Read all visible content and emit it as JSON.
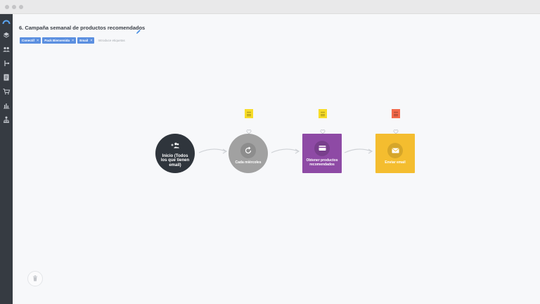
{
  "window": {
    "title": ""
  },
  "sidebar": {
    "items": [
      {
        "icon": "dashboard-logo-icon",
        "active": true
      },
      {
        "icon": "layers-icon"
      },
      {
        "icon": "users-icon"
      },
      {
        "icon": "flow-icon"
      },
      {
        "icon": "document-icon"
      },
      {
        "icon": "cart-icon"
      },
      {
        "icon": "bar-chart-icon"
      },
      {
        "icon": "org-chart-icon"
      }
    ]
  },
  "campaign": {
    "title": "6. Campaña semanal de productos recomendados",
    "tags": [
      {
        "label": "Conectif"
      },
      {
        "label": "Pack Bienvenida"
      },
      {
        "label": "Email"
      }
    ],
    "tag_placeholder": "Introduce etiquetas"
  },
  "flow": {
    "nodes": [
      {
        "id": "start",
        "label": "Inicio (Todos los que tienen email)",
        "color": "#2f353c",
        "icon": "add-users-icon"
      },
      {
        "id": "schedule",
        "label": "Cada miércoles",
        "color": "#a1a1a1",
        "icon": "refresh-icon"
      },
      {
        "id": "products",
        "label": "Obtener productos recomendados",
        "color": "#8e4aa5",
        "icon": "card-icon"
      },
      {
        "id": "email",
        "label": "Enviar email",
        "color": "#f4bd2f",
        "icon": "mail-icon"
      }
    ],
    "notes": [
      {
        "color": "#f7dc28"
      },
      {
        "color": "#f7dc28"
      },
      {
        "color": "#f26a4b"
      }
    ]
  },
  "colors": {
    "accent": "#5b8fe0",
    "sidebar": "#363b42",
    "canvas": "#f7f8fa"
  }
}
